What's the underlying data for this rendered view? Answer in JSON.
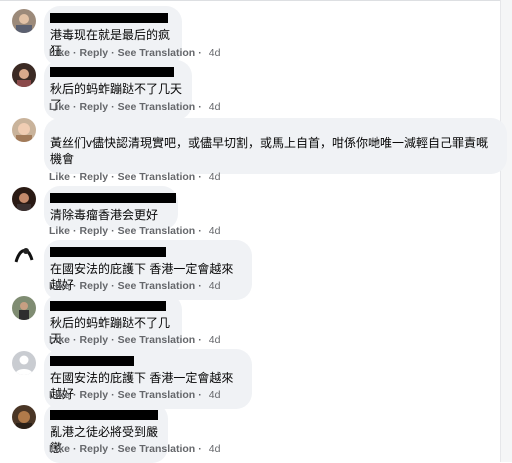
{
  "actions": {
    "like": "Like",
    "reply": "Reply",
    "translate": "See Translation",
    "sep": "·"
  },
  "comments": [
    {
      "text": "港毒现在就是最后的疯狂",
      "time": "4d"
    },
    {
      "text": "秋后的蚂蚱蹦跶不了几天了",
      "time": "4d"
    },
    {
      "text": "黃丝们v儘快認清現實吧，或儘早切割，或馬上自首，咁係你哋唯一減輕自己罪責嘅\n機會",
      "time": "4d"
    },
    {
      "text": "清除毒瘤香港会更好",
      "time": "4d"
    },
    {
      "text": "在國安法的庇護下 香港一定會越來越好",
      "time": "4d"
    },
    {
      "text": "秋后的蚂蚱蹦跶不了几天",
      "time": "4d"
    },
    {
      "text": "在國安法的庇護下 香港一定會越來越好",
      "time": "4d"
    },
    {
      "text": "亂港之徒必將受到嚴懲",
      "time": "4d"
    }
  ]
}
